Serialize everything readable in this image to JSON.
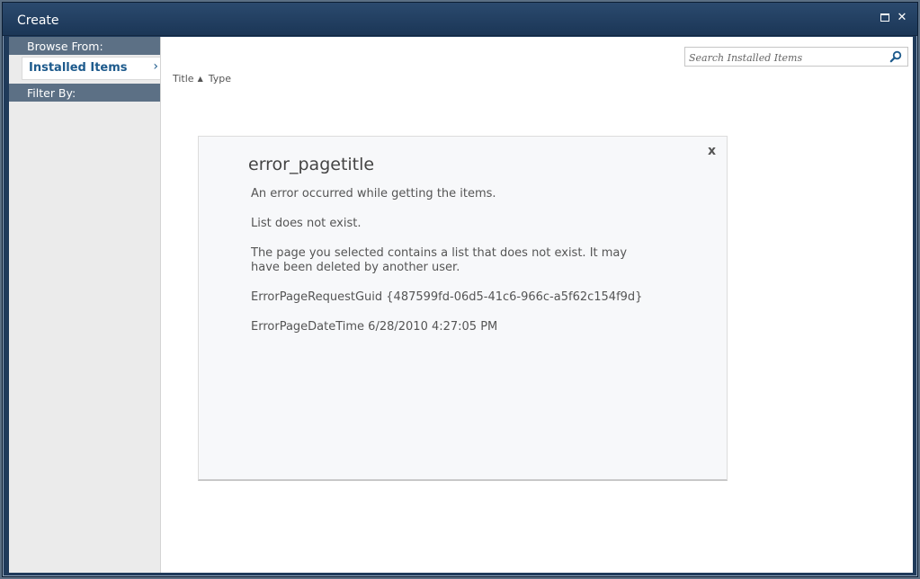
{
  "window": {
    "title": "Create",
    "maximize_icon": "maximize-icon",
    "close_icon": "close-icon",
    "close_glyph": "✕"
  },
  "sidebar": {
    "browse_header": "Browse From:",
    "items": [
      {
        "label": "Installed Items",
        "selected": true,
        "chevron": "›"
      }
    ],
    "filter_header": "Filter By:"
  },
  "toolbar": {
    "sort_title": "Title",
    "sort_arrow": "▲",
    "sort_type": "Type"
  },
  "search": {
    "placeholder": "Search Installed Items",
    "icon": "search-icon"
  },
  "error": {
    "close_label": "x",
    "title": "error_pagetitle",
    "message": "An error occurred while getting the items.",
    "detail": "List does not exist.",
    "description": "The page you selected contains a list that does not exist.  It may have been deleted by another user.",
    "guid_line": "ErrorPageRequestGuid {487599fd-06d5-41c6-966c-a5f62c154f9d}",
    "datetime_line": "ErrorPageDateTime 6/28/2010 4:27:05 PM"
  },
  "colors": {
    "titlebar": "#1f3a5a",
    "sidebar_header": "#5c7085",
    "accent": "#1d5a8c"
  }
}
